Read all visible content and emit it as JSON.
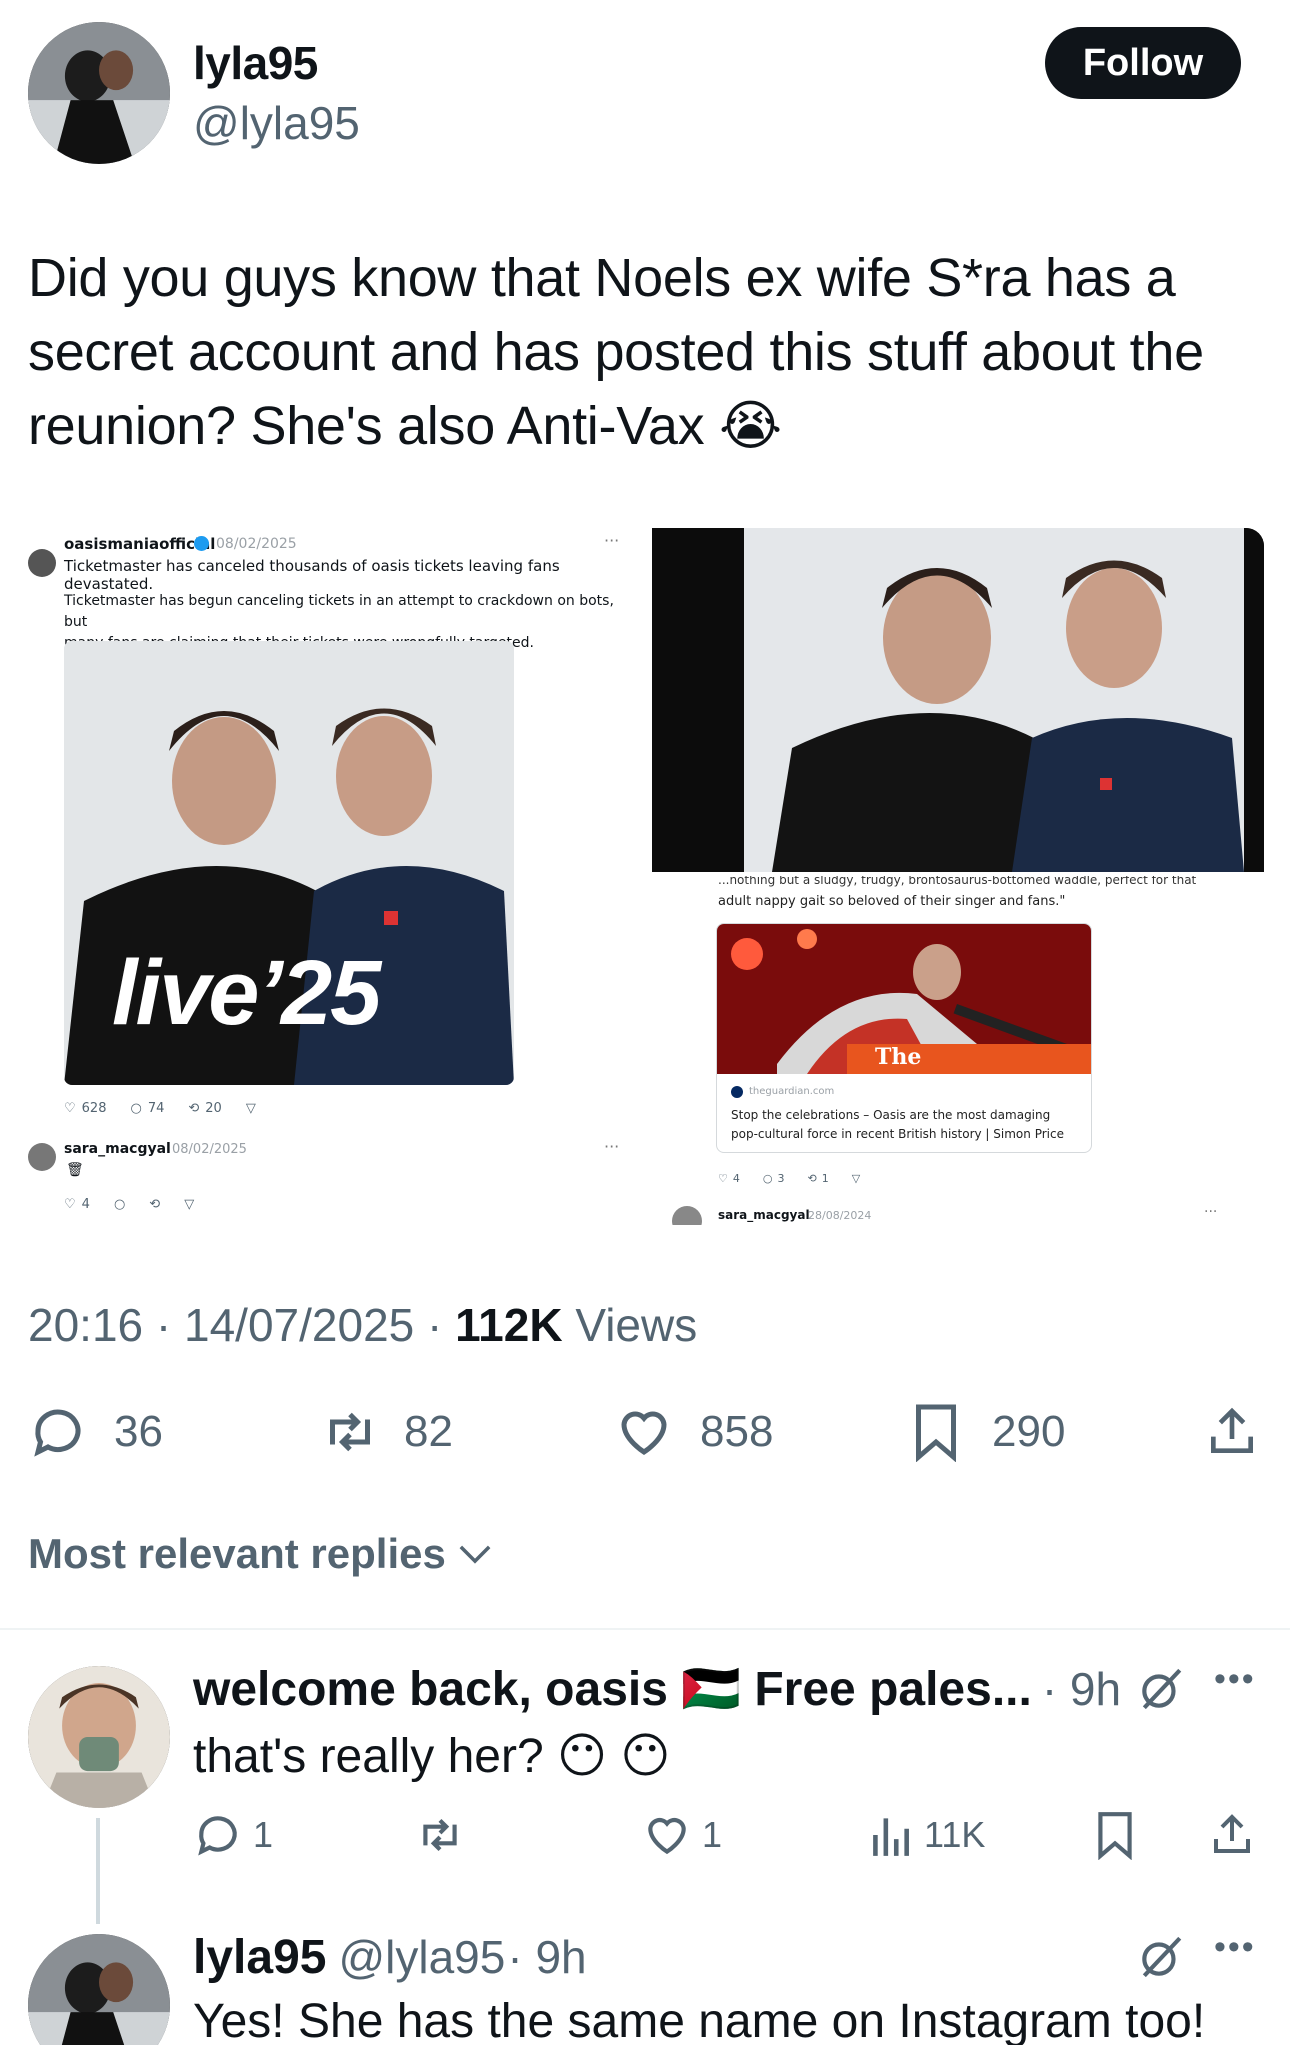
{
  "post": {
    "display_name": "lyla95",
    "handle": "@lyla95",
    "follow_label": "Follow",
    "text_line1": "Did you guys know that Noels ex wife S*ra has a",
    "text_line2": "secret account and has posted this stuff about the",
    "text_line3": "reunion? She's also Anti-Vax 😭",
    "time": "20:16",
    "date": "14/07/2025",
    "views_count": "112K",
    "views_label": "Views",
    "replies": "36",
    "reposts": "82",
    "likes": "858",
    "bookmarks": "290"
  },
  "image_left": {
    "account": "oasismaniaofficial",
    "date": "08/02/2025",
    "more": "···",
    "headline": "Ticketmaster has canceled thousands of oasis tickets leaving fans devastated.",
    "body_line1": "Ticketmaster has begun canceling tickets in an attempt to crackdown on bots, but",
    "body_line2": "many fans are claiming that their tickets were wrongfully targeted.",
    "poster_text": "live’25",
    "likes": "628",
    "comments": "74",
    "reposts": "20",
    "reply_account": "sara_macgyal",
    "reply_date": "08/02/2025",
    "reply_emoji": "🗑",
    "reply_likes": "4"
  },
  "image_right": {
    "quote_line1": "...nothing but a sludgy, trudgy, brontosaurus-bottomed waddle, perfect for that",
    "quote_line2": "adult nappy gait so beloved of their singer and fans.\"",
    "card_brand": "The",
    "card_source": "theguardian.com",
    "card_title_line1": "Stop the celebrations – Oasis are the most damaging",
    "card_title_line2": "pop-cultural force in recent British history | Simon Price",
    "likes": "4",
    "comments": "3",
    "reposts": "1",
    "account": "sara_macgyal",
    "date": "28/08/2024",
    "more": "···"
  },
  "replies_header": {
    "label": "Most relevant replies"
  },
  "reply1": {
    "name": "welcome back, oasis 🇵🇸 Free pales...",
    "time": "· 9h",
    "text": "that's really her? 😶 😶",
    "replies": "1",
    "likes": "1",
    "views": "11K"
  },
  "reply2": {
    "name": "lyla95",
    "handle": "@lyla95",
    "time": "· 9h",
    "text": "Yes! She has the same name on Instagram too!"
  },
  "colors": {
    "text": "#0f1419",
    "secondary": "#536471",
    "divider": "#eff3f4"
  }
}
